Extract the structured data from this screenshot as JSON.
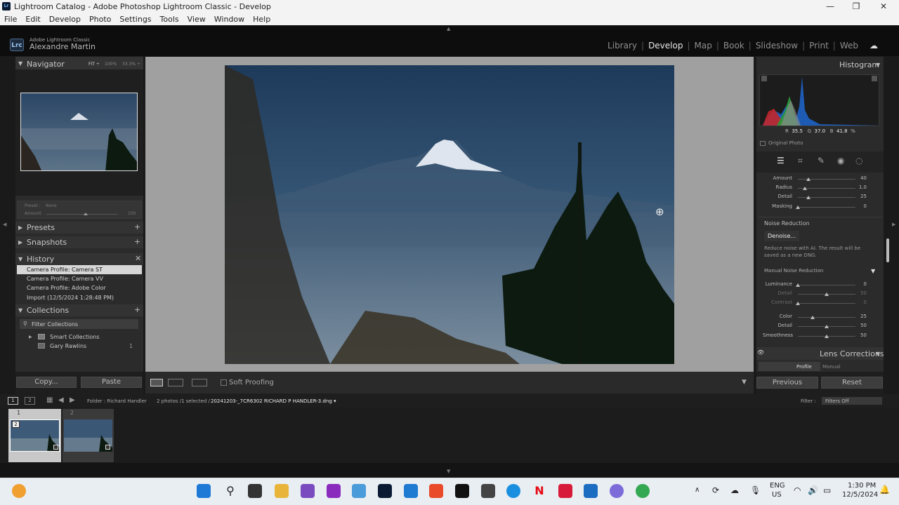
{
  "window": {
    "title": "Lightroom Catalog - Adobe Photoshop Lightroom Classic - Develop",
    "app_icon": "Lr"
  },
  "menu": [
    "File",
    "Edit",
    "Develop",
    "Photo",
    "Settings",
    "Tools",
    "View",
    "Window",
    "Help"
  ],
  "identity": {
    "badge": "Lrc",
    "product": "Adobe Lightroom Classic",
    "user": "Alexandre Martin"
  },
  "modules": [
    {
      "label": "Library",
      "active": false
    },
    {
      "label": "Develop",
      "active": true
    },
    {
      "label": "Map",
      "active": false
    },
    {
      "label": "Book",
      "active": false
    },
    {
      "label": "Slideshow",
      "active": false
    },
    {
      "label": "Print",
      "active": false
    },
    {
      "label": "Web",
      "active": false
    }
  ],
  "navigator": {
    "title": "Navigator",
    "zoom_fit": "FIT ÷",
    "zoom_100": "100%",
    "zoom_other": "33.3% ÷"
  },
  "preset_box": {
    "preset_label": "Preset :",
    "preset_value": "None",
    "amount_label": "Amount",
    "amount_value": "100",
    "amount_fraction": 0.55
  },
  "left_panels": {
    "presets": "Presets",
    "snapshots": "Snapshots",
    "history": "History",
    "collections": "Collections"
  },
  "history": [
    "Camera Profile: Camera ST",
    "Camera Profile: Camera VV",
    "Camera Profile: Adobe Color",
    "Import (12/5/2024 1:28:48 PM)"
  ],
  "collections": {
    "filter": "Filter Collections",
    "items": [
      {
        "label": "Smart Collections",
        "count": ""
      },
      {
        "label": "Gary Rawlins",
        "count": "1"
      }
    ]
  },
  "copy_paste": {
    "copy": "Copy...",
    "paste": "Paste"
  },
  "toolbar": {
    "soft_proofing": "Soft Proofing"
  },
  "histogram": {
    "title": "Histogram",
    "r_label": "R",
    "r": "35.5",
    "g_label": "G",
    "g": "37.0",
    "b_label": "B",
    "b": "41.8",
    "pct": "%",
    "original": "Original Photo"
  },
  "sharpening": [
    {
      "label": "Amount",
      "value": "40",
      "pos": 0.18
    },
    {
      "label": "Radius",
      "value": "1.0",
      "pos": 0.12
    },
    {
      "label": "Detail",
      "value": "25",
      "pos": 0.18
    },
    {
      "label": "Masking",
      "value": "0",
      "pos": 0.0
    }
  ],
  "noise": {
    "title": "Noise Reduction",
    "denoise": "Denoise...",
    "desc": "Reduce noise with AI. The result will be saved as a new DNG.",
    "manual": "Manual Noise Reduction"
  },
  "noise_sliders": [
    {
      "label": "Luminance",
      "value": "0",
      "pos": 0.0,
      "dim": false
    },
    {
      "label": "Detail",
      "value": "50",
      "pos": 0.5,
      "dim": true
    },
    {
      "label": "Contrast",
      "value": "0",
      "pos": 0.0,
      "dim": true
    },
    {
      "label": "Color",
      "value": "25",
      "pos": 0.25,
      "dim": false
    },
    {
      "label": "Detail",
      "value": "50",
      "pos": 0.5,
      "dim": false
    },
    {
      "label": "Smoothness",
      "value": "50",
      "pos": 0.5,
      "dim": false
    }
  ],
  "lens": {
    "title": "Lens Corrections",
    "tab_profile": "Profile",
    "tab_manual": "Manual"
  },
  "right_buttons": {
    "previous": "Previous",
    "reset": "Reset"
  },
  "filmstrip": {
    "page1": "1",
    "page2": "2",
    "folder": "Folder : Richard Handler",
    "count": "2 photos /1 selected /",
    "filename": "20241203-_7CR6302 RICHARD P HANDLER-3.dng ▾",
    "filter_label": "Filter :",
    "filter_value": "Filters Off",
    "thumb1_index": "1",
    "thumb2_index": "2",
    "badge": "2"
  },
  "taskbar": {
    "lang1": "ENG",
    "lang2": "US",
    "time": "1:30 PM",
    "date": "12/5/2024"
  },
  "colors": {
    "accent": "#e8e8e8",
    "panel": "#2b2b2b",
    "center": "#a0a0a0"
  }
}
